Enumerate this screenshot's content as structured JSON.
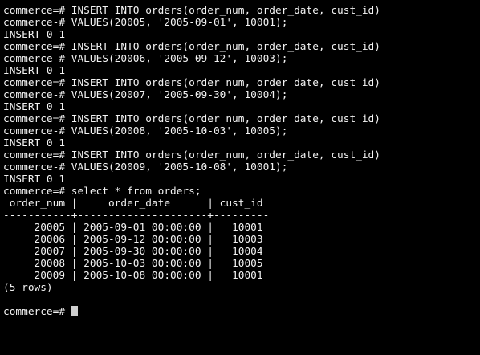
{
  "terminal": {
    "lines": [
      "commerce=# INSERT INTO orders(order_num, order_date, cust_id)",
      "commerce-# VALUES(20005, '2005-09-01', 10001);",
      "INSERT 0 1",
      "commerce=# INSERT INTO orders(order_num, order_date, cust_id)",
      "commerce-# VALUES(20006, '2005-09-12', 10003);",
      "INSERT 0 1",
      "commerce=# INSERT INTO orders(order_num, order_date, cust_id)",
      "commerce-# VALUES(20007, '2005-09-30', 10004);",
      "INSERT 0 1",
      "commerce=# INSERT INTO orders(order_num, order_date, cust_id)",
      "commerce-# VALUES(20008, '2005-10-03', 10005);",
      "INSERT 0 1",
      "commerce=# INSERT INTO orders(order_num, order_date, cust_id)",
      "commerce-# VALUES(20009, '2005-10-08', 10001);",
      "INSERT 0 1",
      "commerce=# select * from orders;",
      " order_num |     order_date      | cust_id",
      "-----------+---------------------+---------",
      "     20005 | 2005-09-01 00:00:00 |   10001",
      "     20006 | 2005-09-12 00:00:00 |   10003",
      "     20007 | 2005-09-30 00:00:00 |   10004",
      "     20008 | 2005-10-03 00:00:00 |   10005",
      "     20009 | 2005-10-08 00:00:00 |   10001",
      "(5 rows)",
      ""
    ],
    "prompt": "commerce=# "
  }
}
